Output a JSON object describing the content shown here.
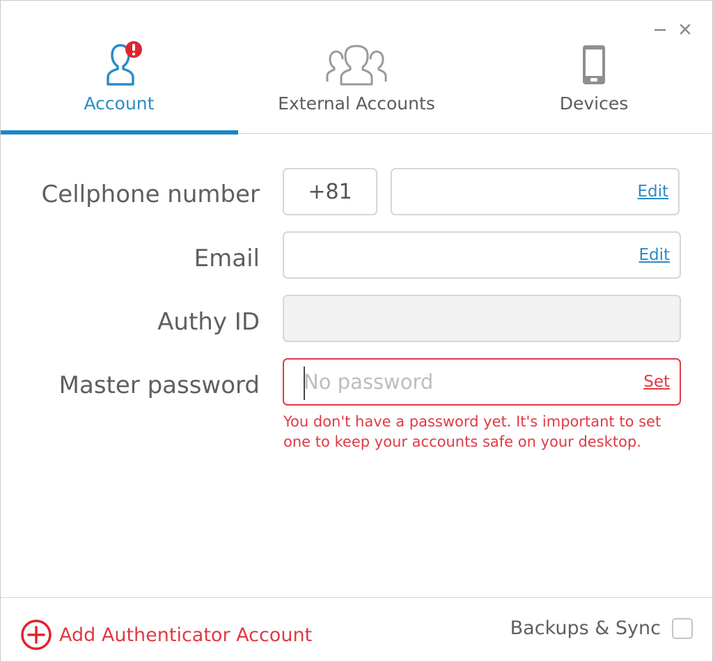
{
  "window": {
    "controls": {
      "minimize": "minimize-icon",
      "close": "close-icon"
    }
  },
  "tabs": [
    {
      "label": "Account",
      "icon": "user-alert-icon",
      "active": true
    },
    {
      "label": "External Accounts",
      "icon": "users-group-icon",
      "active": false
    },
    {
      "label": "Devices",
      "icon": "phone-icon",
      "active": false
    }
  ],
  "form": {
    "cellphone": {
      "label": "Cellphone number",
      "country_code": "+81",
      "value": "",
      "action": "Edit"
    },
    "email": {
      "label": "Email",
      "value": "",
      "action": "Edit"
    },
    "authy_id": {
      "label": "Authy ID",
      "value": ""
    },
    "master_password": {
      "label": "Master password",
      "placeholder": "No password",
      "action": "Set",
      "error": "You don't have a password yet. It's important to set one to keep your accounts safe on your desktop."
    }
  },
  "footer": {
    "add_account": "Add Authenticator Account",
    "backups": "Backups & Sync",
    "backups_checked": false
  },
  "colors": {
    "accent_blue": "#1b86c4",
    "error_red": "#e03a44",
    "text_gray": "#5f5f5f"
  }
}
